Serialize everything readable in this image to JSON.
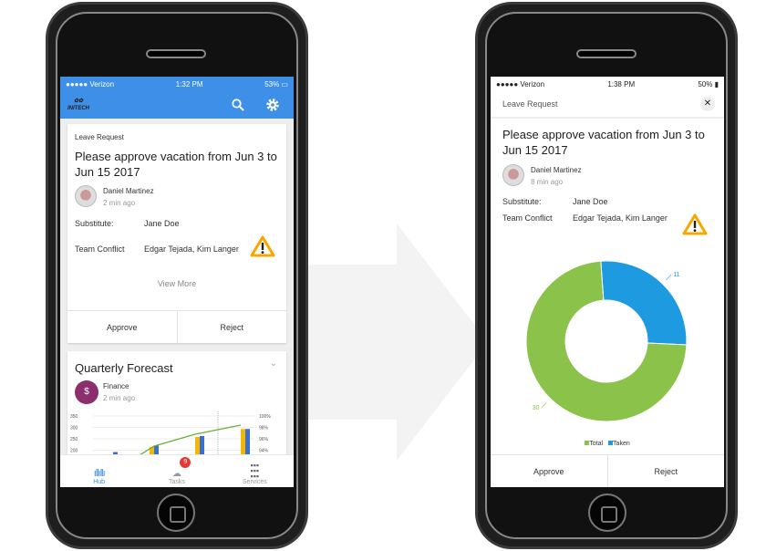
{
  "left": {
    "status": {
      "carrier": "●●●●● Verizon",
      "time": "1:32 PM",
      "battery": "53%"
    },
    "appbar": {
      "logo": "INITECH"
    },
    "leave_card": {
      "category": "Leave Request",
      "title": "Please approve vacation from Jun 3 to Jun 15 2017",
      "author": "Daniel Martinez",
      "time": "2 min ago",
      "substitute_label": "Substitute:",
      "substitute": "Jane Doe",
      "conflict_label": "Team Conflict",
      "conflict": "Edgar Tejada, Kim Langer",
      "view_more": "View More",
      "approve": "Approve",
      "reject": "Reject"
    },
    "forecast_card": {
      "title": "Quarterly Forecast",
      "source": "Finance",
      "time": "2 min ago"
    },
    "tabs": [
      {
        "label": "Hub",
        "icon": "waveform-icon"
      },
      {
        "label": "Tasks",
        "icon": "tasks-icon",
        "badge": "9"
      },
      {
        "label": "Services",
        "icon": "grid-icon"
      }
    ]
  },
  "right": {
    "status": {
      "carrier": "●●●●● Verizon",
      "time": "1:38 PM",
      "battery": "50%"
    },
    "header": {
      "title": "Leave Request"
    },
    "detail": {
      "title": "Please approve vacation from Jun 3 to Jun 15 2017",
      "author": "Daniel Martinez",
      "time": "8 min ago",
      "substitute_label": "Substitute:",
      "substitute": "Jane Doe",
      "conflict_label": "Team Conflict",
      "conflict": "Edgar Tejada, Kim Langer",
      "approve": "Approve",
      "reject": "Reject"
    }
  },
  "chart_data": [
    {
      "type": "bar",
      "title": "Quarterly Forecast",
      "yticks_left": [
        "350",
        "300",
        "250",
        "200"
      ],
      "yticks_right": [
        "100%",
        "98%",
        "96%",
        "94%"
      ],
      "series": [
        {
          "color": "#f5b800",
          "values": [
            null,
            215,
            258,
            293
          ]
        },
        {
          "color": "#3a6fd0",
          "values": [
            192,
            220,
            262,
            293
          ]
        },
        {
          "type": "line",
          "color": "#6ab03a",
          "values": [
            null,
            null,
            null,
            null
          ]
        }
      ],
      "partially_visible": true
    },
    {
      "type": "pie",
      "donut": true,
      "categories": [
        "Total",
        "Taken"
      ],
      "values": [
        30,
        11
      ],
      "colors": [
        "#8bc34a",
        "#1e9be0"
      ],
      "legend": "bottom"
    }
  ]
}
